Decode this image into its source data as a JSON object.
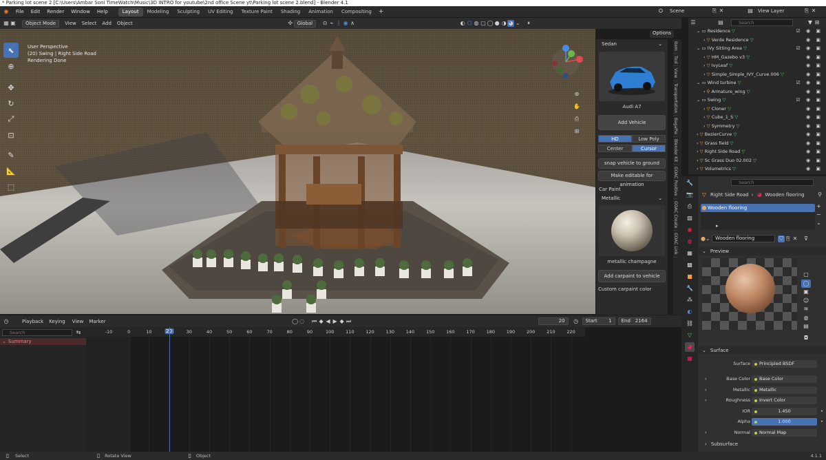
{
  "window_title": "* Parking lot scene 2 [C:\\Users\\Ambar Soni TimeWatch\\Music\\3D INTRO for youtube\\2nd office Scene yt\\Parking lot scene 2.blend] - Blender 4.1",
  "menu": [
    "File",
    "Edit",
    "Render",
    "Window",
    "Help"
  ],
  "workspaces": [
    {
      "label": "Layout",
      "active": true
    },
    {
      "label": "Modeling",
      "active": false
    },
    {
      "label": "Sculpting",
      "active": false
    },
    {
      "label": "UV Editing",
      "active": false
    },
    {
      "label": "Texture Paint",
      "active": false
    },
    {
      "label": "Shading",
      "active": false
    },
    {
      "label": "Animation",
      "active": false
    },
    {
      "label": "Compositing",
      "active": false
    }
  ],
  "add_workspace": "+",
  "scene": {
    "label": "Scene",
    "view_layer": "View Layer"
  },
  "viewport_header": {
    "mode": "Object Mode",
    "menus": [
      "View",
      "Select",
      "Add",
      "Object"
    ],
    "transform": "Global",
    "search_value": "wooden",
    "options": "Options"
  },
  "viewport_info": {
    "line1": "User Perspective",
    "line2": "(20) Swing | Right Side Road",
    "line3": "Rendering Done"
  },
  "gizmo": {
    "x": "X",
    "y": "Y",
    "z": "Z"
  },
  "npanel": {
    "dropdown": "Sedan",
    "car_name": "Audi A7",
    "add_vehicle": "Add Vehicle",
    "quality": [
      {
        "label": "HD",
        "on": true
      },
      {
        "label": "Low Poly",
        "on": false
      }
    ],
    "placement": [
      {
        "label": "Center",
        "on": false
      },
      {
        "label": "Cursor",
        "on": true
      }
    ],
    "snap": "snap vehicle to ground",
    "editable": "Make editable for animation",
    "car_paint_label": "Car Paint",
    "paint_type": "Metallic",
    "paint_name": "metallic champagne",
    "add_paint": "Add carpaint to vehicle",
    "custom_paint": "Custom carpaint color",
    "tabs": [
      "Item",
      "Tool",
      "View",
      "Transportation",
      "BagaPie",
      "Blender Kit",
      "GOAC Positive",
      "GOAC Create",
      "GOAC Link"
    ]
  },
  "outliner": {
    "search_placeholder": "Search",
    "rows": [
      {
        "indent": 1,
        "label": "Residence",
        "type": "collection"
      },
      {
        "indent": 2,
        "label": "Verde Residence",
        "type": "object"
      },
      {
        "indent": 1,
        "label": "IVy Sitting Area",
        "type": "collection"
      },
      {
        "indent": 2,
        "label": "HM_Gazebo v3",
        "type": "object"
      },
      {
        "indent": 2,
        "label": "IvyLeaf",
        "type": "object"
      },
      {
        "indent": 2,
        "label": "Simple_Simple_IVY_Curve.006",
        "type": "object"
      },
      {
        "indent": 1,
        "label": "Wind turbine",
        "type": "collection"
      },
      {
        "indent": 2,
        "label": "Armature_wing",
        "type": "armature"
      },
      {
        "indent": 1,
        "label": "Swing",
        "type": "collection"
      },
      {
        "indent": 2,
        "label": "Cloner",
        "type": "object"
      },
      {
        "indent": 2,
        "label": "Cube_1_S",
        "type": "object"
      },
      {
        "indent": 2,
        "label": "Symmetry",
        "type": "object"
      },
      {
        "indent": 1,
        "label": "BezierCurve",
        "type": "object"
      },
      {
        "indent": 1,
        "label": "Grass field",
        "type": "object"
      },
      {
        "indent": 1,
        "label": "Right Side Road",
        "type": "object"
      },
      {
        "indent": 1,
        "label": "Sc Grass Duo 02.002",
        "type": "object"
      },
      {
        "indent": 1,
        "label": "Volumetrics",
        "type": "object"
      }
    ]
  },
  "properties": {
    "search_placeholder": "Search",
    "breadcrumb": [
      "Right Side Road",
      "Wooden flooring"
    ],
    "slot": "Wooden flooring",
    "material": "Wooden flooring",
    "preview_label": "Preview",
    "surface_label": "Surface",
    "fields": [
      {
        "label": "Surface",
        "value": "Principled BSDF",
        "kind": "link",
        "expand": false
      },
      {
        "label": "Base Color",
        "value": "Base Color",
        "kind": "link",
        "expand": true
      },
      {
        "label": "Metallic",
        "value": "Metallic",
        "kind": "link",
        "expand": true
      },
      {
        "label": "Roughness",
        "value": "Invert Color",
        "kind": "link",
        "expand": true
      },
      {
        "label": "IOR",
        "value": "1.450",
        "kind": "num",
        "expand": false
      },
      {
        "label": "Alpha",
        "value": "1.000",
        "kind": "numblue",
        "expand": false
      },
      {
        "label": "Normal",
        "value": "Normal Map",
        "kind": "link",
        "expand": true
      }
    ],
    "subsurface": "Subsurface"
  },
  "timeline": {
    "menus": [
      "Playback",
      "Keying",
      "View",
      "Marker"
    ],
    "current_frame": "20",
    "start_label": "Start",
    "start": "1",
    "end_label": "End",
    "end": "2164",
    "search_placeholder": "Search",
    "summary": "Summary",
    "ruler": [
      "-10",
      "0",
      "10",
      "20",
      "30",
      "40",
      "50",
      "60",
      "70",
      "80",
      "90",
      "100",
      "110",
      "120",
      "130",
      "140",
      "150",
      "160",
      "170",
      "180",
      "190",
      "200",
      "210",
      "220"
    ]
  },
  "status": {
    "select": "Select",
    "rotate": "Rotate View",
    "object": "Object",
    "version": "4.1.1"
  }
}
